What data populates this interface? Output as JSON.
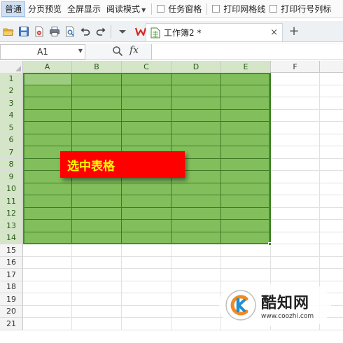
{
  "view_bar": {
    "normal": "普通",
    "page_break_preview": "分页预览",
    "full_screen": "全屏显示",
    "reading_mode": "阅读模式",
    "task_pane": "任务窗格",
    "print_gridlines": "打印网格线",
    "print_headings": "打印行号列标"
  },
  "quick_access": {
    "icons": [
      "open-folder-icon",
      "save-icon",
      "export-pdf-icon",
      "print-icon",
      "print-preview-icon",
      "undo-icon",
      "redo-icon",
      "more-dropdown-icon"
    ]
  },
  "tabs": {
    "document_title": "工作簿2 *",
    "close": "×",
    "new_tab": "+"
  },
  "formula_bar": {
    "cell_reference": "A1",
    "fx": "fx",
    "formula": ""
  },
  "sheet": {
    "column_headers": [
      "A",
      "B",
      "C",
      "D",
      "E",
      "F",
      ""
    ],
    "row_headers": [
      "1",
      "2",
      "3",
      "4",
      "5",
      "6",
      "7",
      "8",
      "9",
      "10",
      "11",
      "12",
      "13",
      "14",
      "15",
      "16",
      "17",
      "18",
      "19",
      "20",
      "21"
    ],
    "selection": "A1:E14",
    "active_cell": "A1",
    "selection_color": "#82bf5c"
  },
  "annotation": {
    "text": "选中表格",
    "background": "#ff0000",
    "text_color": "#ffff00"
  },
  "watermark": {
    "name": "酷知网",
    "url": "www.coozhi.com"
  }
}
